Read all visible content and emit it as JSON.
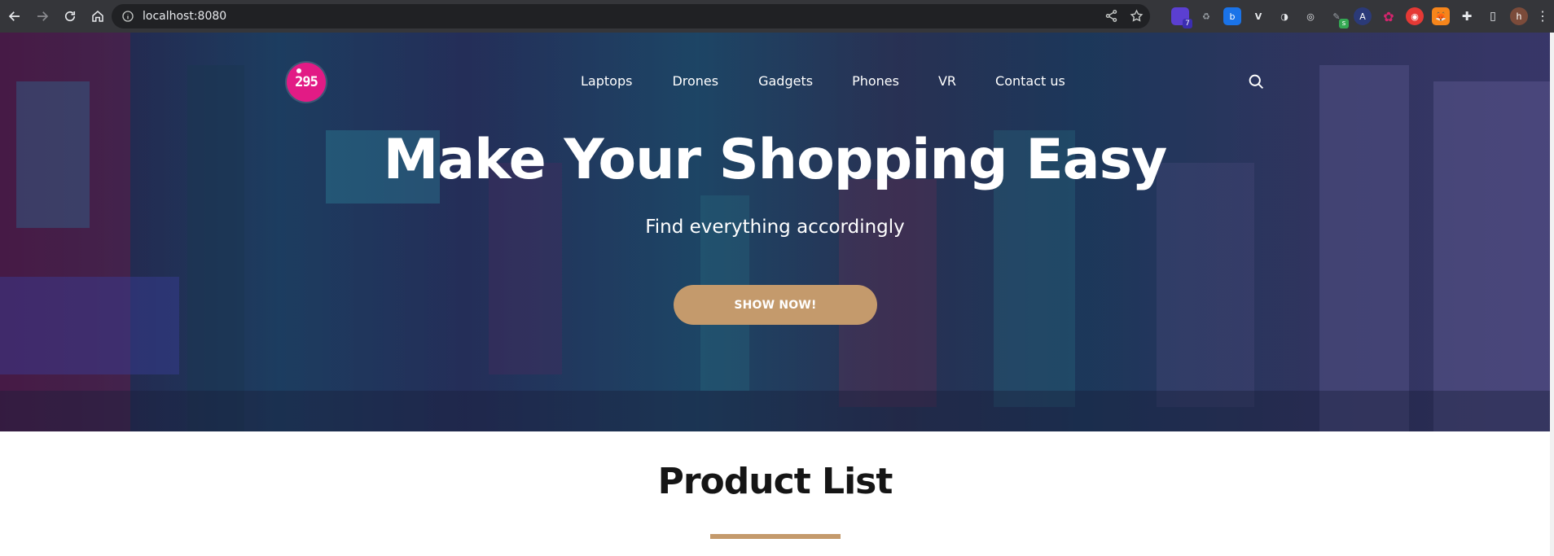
{
  "browser": {
    "url": "localhost:8080",
    "extensions": [
      {
        "icon": "puzzle-hex-icon",
        "color": "#5b3fd1",
        "badge": "7"
      },
      {
        "icon": "recycle-icon",
        "color": "#5f6368",
        "badge": ""
      },
      {
        "icon": "b-shield-icon",
        "color": "#1a73e8",
        "badge": ""
      },
      {
        "icon": "v-icon",
        "color": "#9aa0a6",
        "badge": ""
      },
      {
        "icon": "circle-half-icon",
        "color": "#e8eaed",
        "badge": ""
      },
      {
        "icon": "target-icon",
        "color": "#e8eaed",
        "badge": ""
      },
      {
        "icon": "eyedropper-icon",
        "color": "#34a853",
        "badge": "s"
      },
      {
        "icon": "a-circle-icon",
        "color": "#3b4a8a",
        "badge": ""
      },
      {
        "icon": "gear-pink-icon",
        "color": "#d6246e",
        "badge": ""
      },
      {
        "icon": "red-logo-icon",
        "color": "#e53935",
        "badge": ""
      },
      {
        "icon": "fox-icon",
        "color": "#f6851b",
        "badge": ""
      },
      {
        "icon": "puzzle-icon",
        "color": "#e8eaed",
        "badge": ""
      }
    ],
    "avatar_letter": "h"
  },
  "site": {
    "logo_text": "295",
    "nav": [
      "Laptops",
      "Drones",
      "Gadgets",
      "Phones",
      "VR",
      "Contact us"
    ],
    "hero_title": "Make Your Shopping Easy",
    "hero_subtitle": "Find everything accordingly",
    "cta_label": "SHOW NOW!",
    "section_title": "Product List"
  },
  "colors": {
    "accent": "#c49a6c",
    "logo": "#e21b85",
    "hero_overlay": "#1b244a"
  }
}
